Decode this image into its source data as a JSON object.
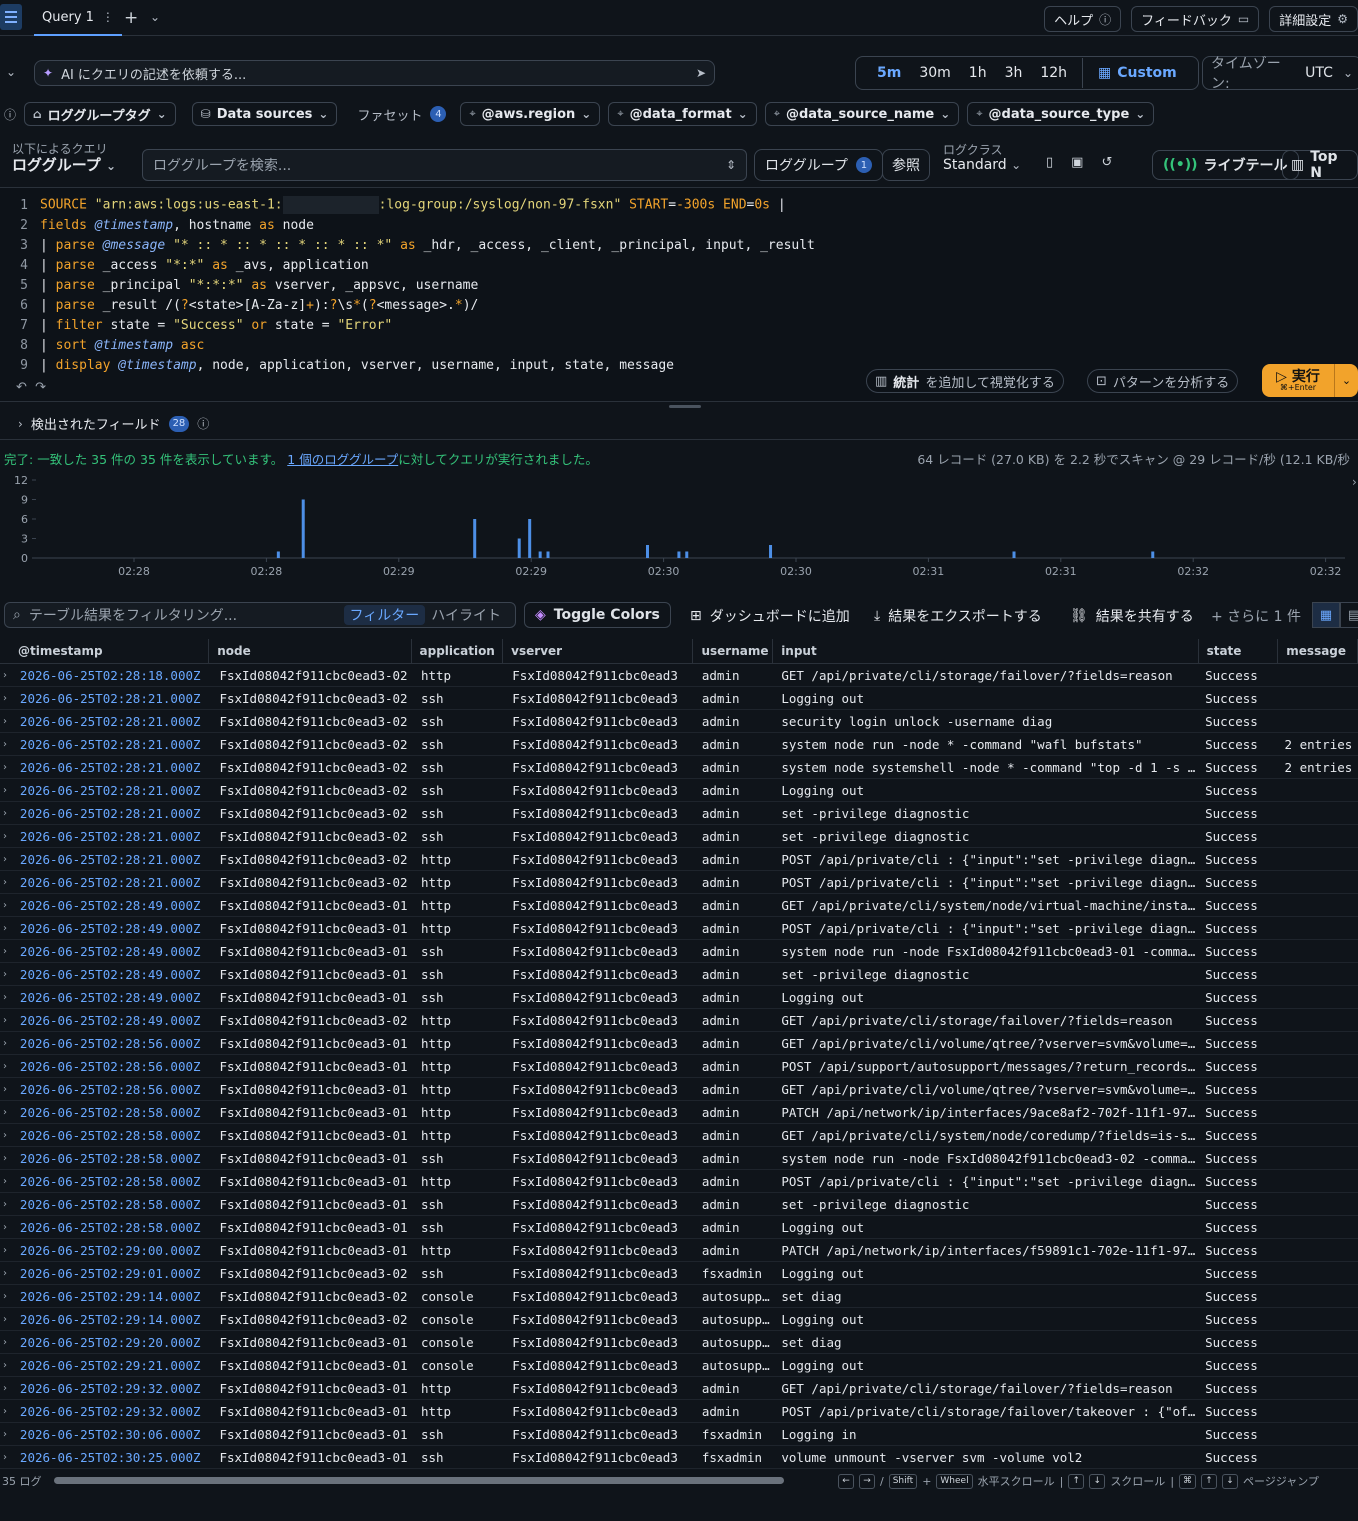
{
  "topbar": {
    "tab_label": "Query 1",
    "help": "ヘルプ",
    "feedback": "フィードバック",
    "settings": "詳細設定"
  },
  "ai": {
    "placeholder": "AI にクエリの記述を依頼する..."
  },
  "time_range": {
    "options": [
      "5m",
      "30m",
      "1h",
      "3h",
      "12h"
    ],
    "active": "5m",
    "custom": "Custom",
    "timezone_label": "タイムゾーン:",
    "timezone_value": "UTC"
  },
  "chips": {
    "log_group_tag": "ロググループタグ",
    "data_sources": "Data sources",
    "facets_label": "ファセット",
    "facets_count": "4",
    "facets": [
      "@aws.region",
      "@data_format",
      "@data_source_name",
      "@data_source_type"
    ]
  },
  "query_bar": {
    "query_by_label": "以下によるクエリ",
    "query_by_value": "ロググループ",
    "search_placeholder": "ロググループを検索...",
    "log_group_btn": "ロググループ",
    "log_group_count": "1",
    "reference_btn": "参照",
    "log_class_label": "ログクラス",
    "log_class_value": "Standard",
    "live_tail": "ライブテール",
    "top_n": "Top N"
  },
  "editor": {
    "line1_pre": "\"arn:aws:logs:us-east-1:",
    "line1_post": ":log-group:/syslog/non-97-fsxn\"",
    "line1_start": "-300s",
    "line1_end": "0s",
    "stats_btn_b": "統計",
    "stats_btn_rest": "を追加して視覚化する",
    "pattern_btn": "パターンを分析する",
    "run_label": "実行",
    "run_shortcut": "⌘+Enter"
  },
  "fields": {
    "label": "検出されたフィールド",
    "count": "28"
  },
  "status": {
    "done": "完了:",
    "text": "一致した 35 件の 35 件を表示しています。",
    "link": "1 個のロググループ",
    "text2": "に対してクエリが実行されました。",
    "scanned": "64 レコード (27.0 KB) を 2.2 秒でスキャン @ 29 レコード/秒 (12.1 KB/秒"
  },
  "chart_data": {
    "type": "bar",
    "y_ticks": [
      0,
      3,
      6,
      9,
      12
    ],
    "ylim": [
      0,
      12
    ],
    "x_tick_labels": [
      "02:28",
      "02:28",
      "02:29",
      "02:29",
      "02:30",
      "02:30",
      "02:31",
      "02:31",
      "02:32",
      "02:32"
    ],
    "bars": [
      {
        "t": 0.184,
        "v": 1
      },
      {
        "t": 0.203,
        "v": 9
      },
      {
        "t": 0.334,
        "v": 6
      },
      {
        "t": 0.368,
        "v": 3
      },
      {
        "t": 0.376,
        "v": 6
      },
      {
        "t": 0.384,
        "v": 1
      },
      {
        "t": 0.39,
        "v": 1
      },
      {
        "t": 0.466,
        "v": 2
      },
      {
        "t": 0.49,
        "v": 1
      },
      {
        "t": 0.496,
        "v": 1
      },
      {
        "t": 0.56,
        "v": 2
      },
      {
        "t": 0.746,
        "v": 1
      },
      {
        "t": 0.852,
        "v": 1
      }
    ]
  },
  "table_toolbar": {
    "filter_placeholder": "テーブル結果をフィルタリング...",
    "filter_tab": "フィルター",
    "highlight_tab": "ハイライト",
    "toggle_colors": "Toggle Colors",
    "add_dashboard": "ダッシュボードに追加",
    "export": "結果をエクスポートする",
    "share": "結果を共有する",
    "more": "+ さらに 1 件"
  },
  "table": {
    "columns": [
      "@timestamp",
      "node",
      "application",
      "vserver",
      "username",
      "input",
      "state",
      "message"
    ],
    "rows": [
      [
        "2026-06-25T02:28:18.000Z",
        "FsxId08042f911cbc0ead3-02",
        "http",
        "FsxId08042f911cbc0ead3",
        "admin",
        "GET /api/private/cli/storage/failover/?fields=reason",
        "Success",
        ""
      ],
      [
        "2026-06-25T02:28:21.000Z",
        "FsxId08042f911cbc0ead3-02",
        "ssh",
        "FsxId08042f911cbc0ead3",
        "admin",
        "Logging out",
        "Success",
        ""
      ],
      [
        "2026-06-25T02:28:21.000Z",
        "FsxId08042f911cbc0ead3-02",
        "ssh",
        "FsxId08042f911cbc0ead3",
        "admin",
        "security login unlock -username diag",
        "Success",
        ""
      ],
      [
        "2026-06-25T02:28:21.000Z",
        "FsxId08042f911cbc0ead3-02",
        "ssh",
        "FsxId08042f911cbc0ead3",
        "admin",
        "system node run -node * -command \"wafl bufstats\"",
        "Success",
        "2 entries"
      ],
      [
        "2026-06-25T02:28:21.000Z",
        "FsxId08042f911cbc0ead3-02",
        "ssh",
        "FsxId08042f911cbc0ead3",
        "admin",
        "system node systemshell -node * -command \"top -d 1 -s 1\"",
        "Success",
        "2 entries"
      ],
      [
        "2026-06-25T02:28:21.000Z",
        "FsxId08042f911cbc0ead3-02",
        "ssh",
        "FsxId08042f911cbc0ead3",
        "admin",
        "Logging out",
        "Success",
        ""
      ],
      [
        "2026-06-25T02:28:21.000Z",
        "FsxId08042f911cbc0ead3-02",
        "ssh",
        "FsxId08042f911cbc0ead3",
        "admin",
        "set -privilege diagnostic",
        "Success",
        ""
      ],
      [
        "2026-06-25T02:28:21.000Z",
        "FsxId08042f911cbc0ead3-02",
        "ssh",
        "FsxId08042f911cbc0ead3",
        "admin",
        "set -privilege diagnostic",
        "Success",
        ""
      ],
      [
        "2026-06-25T02:28:21.000Z",
        "FsxId08042f911cbc0ead3-02",
        "http",
        "FsxId08042f911cbc0ead3",
        "admin",
        "POST /api/private/cli : {\"input\":\"set -privilege diagnos…",
        "Success",
        ""
      ],
      [
        "2026-06-25T02:28:21.000Z",
        "FsxId08042f911cbc0ead3-02",
        "http",
        "FsxId08042f911cbc0ead3",
        "admin",
        "POST /api/private/cli : {\"input\":\"set -privilege diagnos…",
        "Success",
        ""
      ],
      [
        "2026-06-25T02:28:49.000Z",
        "FsxId08042f911cbc0ead3-01",
        "http",
        "FsxId08042f911cbc0ead3",
        "admin",
        "GET /api/private/cli/system/node/virtual-machine/instanc…",
        "Success",
        ""
      ],
      [
        "2026-06-25T02:28:49.000Z",
        "FsxId08042f911cbc0ead3-01",
        "http",
        "FsxId08042f911cbc0ead3",
        "admin",
        "POST /api/private/cli : {\"input\":\"set -privilege diagnos…",
        "Success",
        ""
      ],
      [
        "2026-06-25T02:28:49.000Z",
        "FsxId08042f911cbc0ead3-01",
        "ssh",
        "FsxId08042f911cbc0ead3",
        "admin",
        "system node run -node FsxId08042f911cbc0ead3-01 -command…",
        "Success",
        ""
      ],
      [
        "2026-06-25T02:28:49.000Z",
        "FsxId08042f911cbc0ead3-01",
        "ssh",
        "FsxId08042f911cbc0ead3",
        "admin",
        "set -privilege diagnostic",
        "Success",
        ""
      ],
      [
        "2026-06-25T02:28:49.000Z",
        "FsxId08042f911cbc0ead3-01",
        "ssh",
        "FsxId08042f911cbc0ead3",
        "admin",
        "Logging out",
        "Success",
        ""
      ],
      [
        "2026-06-25T02:28:49.000Z",
        "FsxId08042f911cbc0ead3-02",
        "http",
        "FsxId08042f911cbc0ead3",
        "admin",
        "GET /api/private/cli/storage/failover/?fields=reason",
        "Success",
        ""
      ],
      [
        "2026-06-25T02:28:56.000Z",
        "FsxId08042f911cbc0ead3-01",
        "http",
        "FsxId08042f911cbc0ead3",
        "admin",
        "GET /api/private/cli/volume/qtree/?vserver=svm&volume=sv…",
        "Success",
        ""
      ],
      [
        "2026-06-25T02:28:56.000Z",
        "FsxId08042f911cbc0ead3-01",
        "http",
        "FsxId08042f911cbc0ead3",
        "admin",
        "POST /api/support/autosupport/messages/?return_records=t…",
        "Success",
        ""
      ],
      [
        "2026-06-25T02:28:56.000Z",
        "FsxId08042f911cbc0ead3-01",
        "http",
        "FsxId08042f911cbc0ead3",
        "admin",
        "GET /api/private/cli/volume/qtree/?vserver=svm&volume=vo…",
        "Success",
        ""
      ],
      [
        "2026-06-25T02:28:58.000Z",
        "FsxId08042f911cbc0ead3-01",
        "http",
        "FsxId08042f911cbc0ead3",
        "admin",
        "PATCH /api/network/ip/interfaces/9ace8af2-702f-11f1-97f1…",
        "Success",
        ""
      ],
      [
        "2026-06-25T02:28:58.000Z",
        "FsxId08042f911cbc0ead3-01",
        "http",
        "FsxId08042f911cbc0ead3",
        "admin",
        "GET /api/private/cli/system/node/coredump/?fields=is-sav…",
        "Success",
        ""
      ],
      [
        "2026-06-25T02:28:58.000Z",
        "FsxId08042f911cbc0ead3-01",
        "ssh",
        "FsxId08042f911cbc0ead3",
        "admin",
        "system node run -node FsxId08042f911cbc0ead3-02 -command…",
        "Success",
        ""
      ],
      [
        "2026-06-25T02:28:58.000Z",
        "FsxId08042f911cbc0ead3-01",
        "http",
        "FsxId08042f911cbc0ead3",
        "admin",
        "POST /api/private/cli : {\"input\":\"set -privilege diagnos…",
        "Success",
        ""
      ],
      [
        "2026-06-25T02:28:58.000Z",
        "FsxId08042f911cbc0ead3-01",
        "ssh",
        "FsxId08042f911cbc0ead3",
        "admin",
        "set -privilege diagnostic",
        "Success",
        ""
      ],
      [
        "2026-06-25T02:28:58.000Z",
        "FsxId08042f911cbc0ead3-01",
        "ssh",
        "FsxId08042f911cbc0ead3",
        "admin",
        "Logging out",
        "Success",
        ""
      ],
      [
        "2026-06-25T02:29:00.000Z",
        "FsxId08042f911cbc0ead3-01",
        "http",
        "FsxId08042f911cbc0ead3",
        "admin",
        "PATCH /api/network/ip/interfaces/f59891c1-702e-11f1-97f1…",
        "Success",
        ""
      ],
      [
        "2026-06-25T02:29:01.000Z",
        "FsxId08042f911cbc0ead3-02",
        "ssh",
        "FsxId08042f911cbc0ead3",
        "fsxadmin",
        "Logging out",
        "Success",
        ""
      ],
      [
        "2026-06-25T02:29:14.000Z",
        "FsxId08042f911cbc0ead3-02",
        "console",
        "FsxId08042f911cbc0ead3",
        "autosupp…",
        "set diag",
        "Success",
        ""
      ],
      [
        "2026-06-25T02:29:14.000Z",
        "FsxId08042f911cbc0ead3-02",
        "console",
        "FsxId08042f911cbc0ead3",
        "autosupp…",
        "Logging out",
        "Success",
        ""
      ],
      [
        "2026-06-25T02:29:20.000Z",
        "FsxId08042f911cbc0ead3-01",
        "console",
        "FsxId08042f911cbc0ead3",
        "autosupp…",
        "set diag",
        "Success",
        ""
      ],
      [
        "2026-06-25T02:29:21.000Z",
        "FsxId08042f911cbc0ead3-01",
        "console",
        "FsxId08042f911cbc0ead3",
        "autosupp…",
        "Logging out",
        "Success",
        ""
      ],
      [
        "2026-06-25T02:29:32.000Z",
        "FsxId08042f911cbc0ead3-01",
        "http",
        "FsxId08042f911cbc0ead3",
        "admin",
        "GET /api/private/cli/storage/failover/?fields=reason",
        "Success",
        ""
      ],
      [
        "2026-06-25T02:29:32.000Z",
        "FsxId08042f911cbc0ead3-01",
        "http",
        "FsxId08042f911cbc0ead3",
        "admin",
        "POST /api/private/cli/storage/failover/takeover : {\"ofno…",
        "Success",
        ""
      ],
      [
        "2026-06-25T02:30:06.000Z",
        "FsxId08042f911cbc0ead3-01",
        "ssh",
        "FsxId08042f911cbc0ead3",
        "fsxadmin",
        "Logging in",
        "Success",
        ""
      ],
      [
        "2026-06-25T02:30:25.000Z",
        "FsxId08042f911cbc0ead3-01",
        "ssh",
        "FsxId08042f911cbc0ead3",
        "fsxadmin",
        "volume unmount -vserver svm -volume vol2",
        "Success",
        ""
      ]
    ]
  },
  "footer": {
    "count": "35 ログ",
    "hscroll": "水平スクロール",
    "vscroll": "スクロール",
    "pagejump": "ページジャンプ",
    "shift": "Shift",
    "wheel": "Wheel"
  },
  "colors": {
    "accent": "#6aa8ff",
    "run": "#f2a32b",
    "success_text": "#34c37a",
    "histogram": "#4d8fe6"
  }
}
